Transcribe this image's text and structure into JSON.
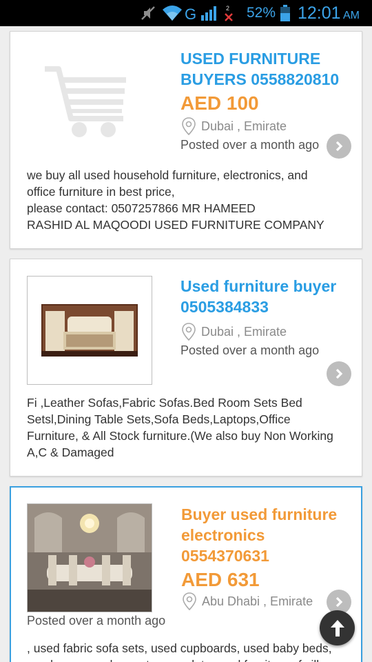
{
  "status_bar": {
    "carrier_type": "G",
    "sim_badge": "2",
    "battery_percent": "52%",
    "time": "12:01",
    "ampm": "AM",
    "accent_color": "#3ba3e8",
    "icons": [
      "mute-icon",
      "wifi-icon",
      "signal-icon",
      "no-sim-icon",
      "battery-icon"
    ]
  },
  "listings": [
    {
      "title_line1": "USED FURNITURE",
      "title_line2": "BUYERS 0558820810",
      "price": "AED 100",
      "location": "Dubai , Emirate",
      "posted": "Posted over a month ago",
      "image": "cart-placeholder-icon",
      "description": [
        "we buy all used household furniture, electronics, and",
        "office furniture in best price,",
        "please contact: 0507257866 MR HAMEED",
        "RASHID AL MAQOODI USED FURNITURE COMPANY"
      ]
    },
    {
      "title_line1": "Used furniture buyer",
      "title_line2": "0505384833",
      "location": "Dubai , Emirate",
      "posted": "Posted over a month ago",
      "image": "bedroom-set-photo",
      "description": [
        "Fi ,Leather Sofas,Fabric Sofas.Bed Room Sets Bed",
        "Setsl,Dining Table Sets,Sofa Beds,Laptops,Office",
        "Furniture, & All Stock furniture.(We also buy Non Working",
        "A,C & Damaged"
      ]
    },
    {
      "title_line1": "Buyer used furniture",
      "title_line2": "electronics",
      "title_line3": "0554370631",
      "price": "AED 631",
      "location": "Abu Dhabi , Emirate",
      "posted": "Posted over a month ago",
      "image": "dining-room-photo",
      "description": [
        ", used fabric sofa sets, used cupboards, used baby beds,",
        "used rugs, used carpets, complete used furniture of villas"
      ]
    }
  ],
  "colors": {
    "title_blue": "#2a9de3",
    "price_orange": "#f29a38",
    "selected_border": "#3aa0e0"
  },
  "fab": {
    "icon": "arrow-up-icon"
  }
}
